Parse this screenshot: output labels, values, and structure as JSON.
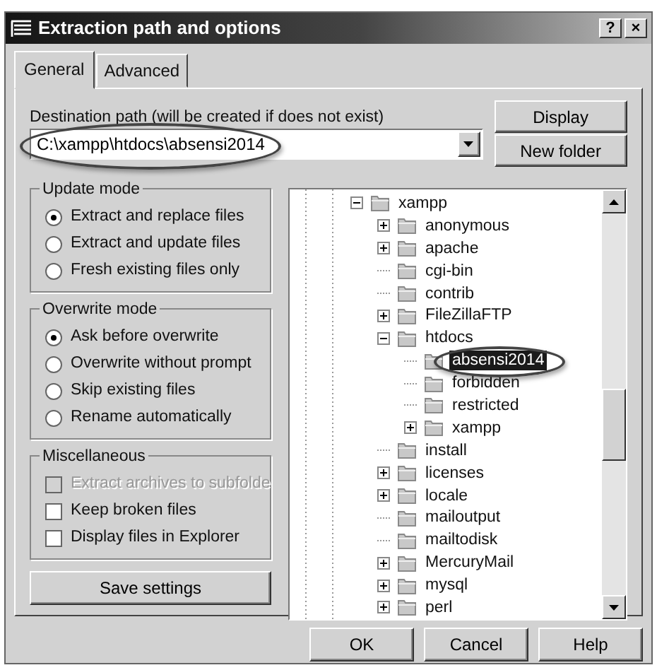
{
  "window": {
    "title": "Extraction path and options",
    "title_buttons": [
      "?",
      "×"
    ]
  },
  "tabs": [
    {
      "label": "General",
      "selected": true
    },
    {
      "label": "Advanced",
      "selected": false
    }
  ],
  "destination": {
    "label": "Destination path (will be created if does not exist)",
    "value": "C:\\xampp\\htdocs\\absensi2014",
    "circled": true
  },
  "side_buttons": [
    "Display",
    "New folder"
  ],
  "groups": [
    {
      "title": "Update mode",
      "items": [
        {
          "kind": "radio",
          "label": "Extract and replace files",
          "selected": true,
          "disabled": false
        },
        {
          "kind": "radio",
          "label": "Extract and update files",
          "selected": false,
          "disabled": false
        },
        {
          "kind": "radio",
          "label": "Fresh existing files only",
          "selected": false,
          "disabled": false
        }
      ]
    },
    {
      "title": "Overwrite mode",
      "items": [
        {
          "kind": "radio",
          "label": "Ask before overwrite",
          "selected": true,
          "disabled": false
        },
        {
          "kind": "radio",
          "label": "Overwrite without prompt",
          "selected": false,
          "disabled": false
        },
        {
          "kind": "radio",
          "label": "Skip existing files",
          "selected": false,
          "disabled": false
        },
        {
          "kind": "radio",
          "label": "Rename automatically",
          "selected": false,
          "disabled": false
        }
      ]
    },
    {
      "title": "Miscellaneous",
      "items": [
        {
          "kind": "checkbox",
          "label": "Extract archives to subfolde",
          "checked": false,
          "disabled": true
        },
        {
          "kind": "checkbox",
          "label": "Keep broken files",
          "checked": false,
          "disabled": false
        },
        {
          "kind": "checkbox",
          "label": "Display files in Explorer",
          "checked": false,
          "disabled": false
        }
      ]
    }
  ],
  "save_button": "Save settings",
  "tree": [
    {
      "label": "xampp",
      "expanded": true,
      "selected": false,
      "children": [
        {
          "label": "anonymous",
          "expanded": false,
          "selected": false
        },
        {
          "label": "apache",
          "expanded": false,
          "selected": false
        },
        {
          "label": "cgi-bin",
          "selected": false
        },
        {
          "label": "contrib",
          "selected": false
        },
        {
          "label": "FileZillaFTP",
          "expanded": false,
          "selected": false
        },
        {
          "label": "htdocs",
          "expanded": true,
          "selected": false,
          "children": [
            {
              "label": "absensi2014",
              "selected": true,
              "circled": true
            },
            {
              "label": "forbidden",
              "selected": false
            },
            {
              "label": "restricted",
              "selected": false
            },
            {
              "label": "xampp",
              "expanded": false,
              "selected": false
            }
          ]
        },
        {
          "label": "install",
          "selected": false
        },
        {
          "label": "licenses",
          "expanded": false,
          "selected": false
        },
        {
          "label": "locale",
          "expanded": false,
          "selected": false
        },
        {
          "label": "mailoutput",
          "selected": false
        },
        {
          "label": "mailtodisk",
          "selected": false
        },
        {
          "label": "MercuryMail",
          "expanded": false,
          "selected": false
        },
        {
          "label": "mysql",
          "expanded": false,
          "selected": false
        },
        {
          "label": "perl",
          "expanded": false,
          "selected": false
        }
      ]
    }
  ],
  "footer_buttons": [
    "OK",
    "Cancel",
    "Help"
  ]
}
